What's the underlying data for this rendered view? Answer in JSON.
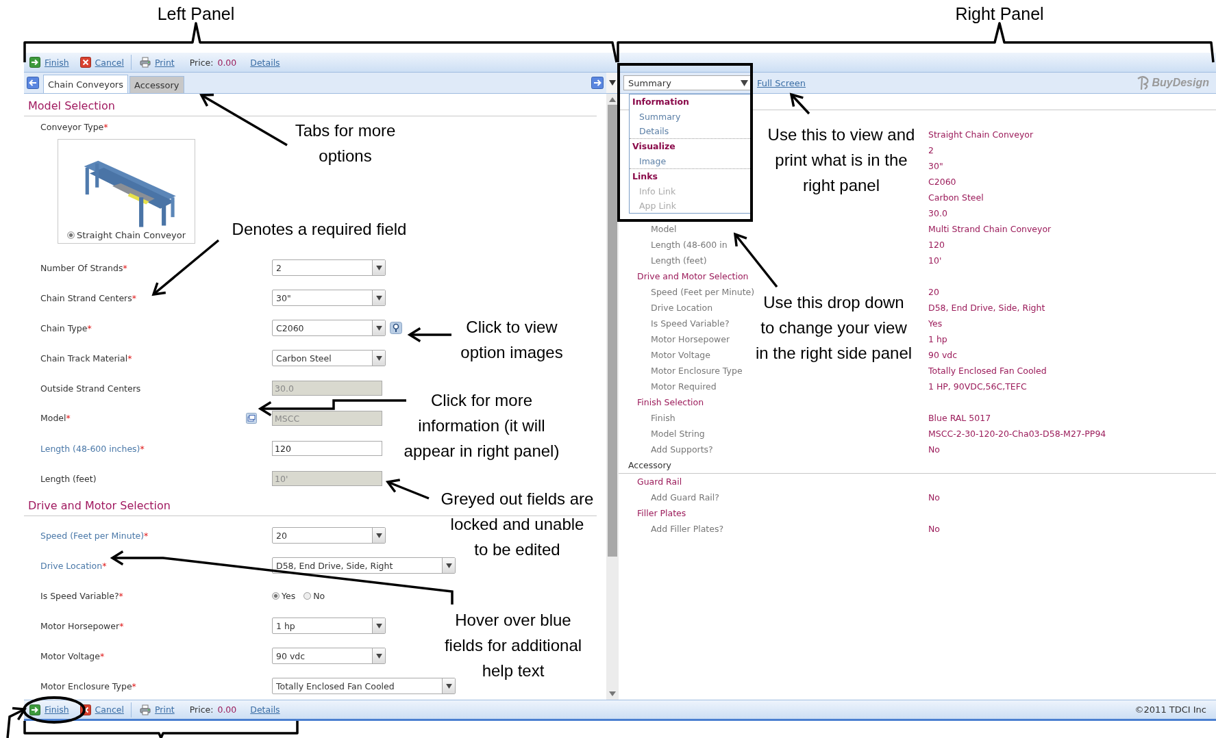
{
  "callouts": [
    {
      "kind": "panel",
      "lines": [
        "Left Panel"
      ]
    },
    {
      "kind": "panel",
      "lines": [
        "Right Panel"
      ]
    },
    {
      "kind": "note",
      "lines": [
        "Tabs for more",
        "options"
      ]
    },
    {
      "kind": "note",
      "lines": [
        "Denotes a required field"
      ]
    },
    {
      "kind": "note",
      "lines": [
        "Click to view",
        "option images"
      ]
    },
    {
      "kind": "note",
      "lines": [
        "Click for more",
        "information (it will",
        "appear in right panel)"
      ]
    },
    {
      "kind": "note",
      "lines": [
        "Greyed out fields are",
        "locked and unable",
        "to be edited"
      ]
    },
    {
      "kind": "note",
      "lines": [
        "Hover over blue",
        "fields for additional",
        "help text"
      ]
    },
    {
      "kind": "note",
      "lines": [
        "Use this to view and",
        "print what is in the",
        "right panel"
      ]
    },
    {
      "kind": "note",
      "lines": [
        "Use this drop down",
        "to change your view",
        "in the right side panel"
      ]
    }
  ],
  "toolbar": {
    "actions": [
      {
        "kind": "finish",
        "label": "Finish"
      },
      {
        "kind": "cancel",
        "label": "Cancel"
      },
      {
        "kind": "print",
        "label": "Print"
      }
    ],
    "price_label": "Price:",
    "price": "0.00",
    "details": "Details"
  },
  "tabs": [
    {
      "label": "Chain Conveyors",
      "selected": true
    },
    {
      "label": "Accessory",
      "selected": false
    }
  ],
  "view_select": {
    "value": "Summary",
    "menu": [
      {
        "kind": "group",
        "label": "Information"
      },
      {
        "kind": "item",
        "label": "Summary",
        "disabled": false
      },
      {
        "kind": "item",
        "label": "Details",
        "disabled": false
      },
      {
        "kind": "group",
        "label": "Visualize"
      },
      {
        "kind": "item",
        "label": "Image",
        "disabled": false
      },
      {
        "kind": "group",
        "label": "Links"
      },
      {
        "kind": "item",
        "label": "Info Link",
        "disabled": true
      },
      {
        "kind": "item",
        "label": "App Link",
        "disabled": true
      }
    ]
  },
  "full_screen": "Full Screen",
  "logo": "BuyDesign",
  "form": {
    "required_mark": "*",
    "sections": [
      {
        "title": "Model Selection",
        "fields": [
          {
            "kind": "image_choice",
            "label": "Conveyor Type",
            "required": true,
            "help": false,
            "option": {
              "label": "Straight Chain Conveyor",
              "selected": true
            }
          },
          {
            "kind": "select",
            "label": "Number Of Strands",
            "required": true,
            "help": false,
            "value": "2"
          },
          {
            "kind": "select",
            "label": "Chain Strand Centers",
            "required": true,
            "help": false,
            "value": "30\""
          },
          {
            "kind": "select",
            "label": "Chain Type",
            "required": true,
            "help": false,
            "value": "C2060",
            "extra": {
              "kind": "zoom"
            }
          },
          {
            "kind": "select",
            "label": "Chain Track Material",
            "required": true,
            "help": false,
            "value": "Carbon Steel"
          },
          {
            "kind": "text",
            "label": "Outside Strand Centers",
            "required": false,
            "help": false,
            "value": "30.0",
            "locked": true
          },
          {
            "kind": "text",
            "label": "Model",
            "required": true,
            "help": false,
            "value": "MSCC",
            "locked": true,
            "extra": {
              "kind": "info"
            }
          },
          {
            "kind": "text",
            "label": "Length (48-600 inches)",
            "required": true,
            "help": true,
            "value": "120",
            "locked": false
          },
          {
            "kind": "text",
            "label": "Length (feet)",
            "required": false,
            "help": false,
            "value": "10'",
            "locked": true
          }
        ]
      },
      {
        "title": "Drive and Motor Selection",
        "fields": [
          {
            "kind": "select",
            "label": "Speed (Feet per Minute)",
            "required": true,
            "help": true,
            "value": "20"
          },
          {
            "kind": "select",
            "label": "Drive Location",
            "required": true,
            "help": true,
            "value": "D58, End Drive, Side, Right"
          },
          {
            "kind": "radio",
            "label": "Is Speed Variable?",
            "required": true,
            "help": false,
            "options": [
              {
                "label": "Yes",
                "selected": true
              },
              {
                "label": "No",
                "selected": false
              }
            ]
          },
          {
            "kind": "select",
            "label": "Motor Horsepower",
            "required": true,
            "help": false,
            "value": "1 hp"
          },
          {
            "kind": "select",
            "label": "Motor Voltage",
            "required": true,
            "help": false,
            "value": "90 vdc"
          },
          {
            "kind": "select",
            "label": "Motor Enclosure Type",
            "required": true,
            "help": false,
            "value": "Totally Enclosed Fan Cooled"
          }
        ]
      }
    ]
  },
  "summary": [
    {
      "kind": "row",
      "value": "Straight Chain Conveyor"
    },
    {
      "kind": "row",
      "value": "2"
    },
    {
      "kind": "row",
      "value": "30\""
    },
    {
      "kind": "row",
      "value": "C2060"
    },
    {
      "kind": "row",
      "value": "Carbon Steel"
    },
    {
      "kind": "row",
      "value": "30.0"
    },
    {
      "kind": "row",
      "label": "Model",
      "value": "Multi Strand Chain Conveyor"
    },
    {
      "kind": "row",
      "label": "Length (48-600 in",
      "value": "120"
    },
    {
      "kind": "row",
      "label": "Length (feet)",
      "value": "10'"
    },
    {
      "kind": "section",
      "label": "Drive and Motor Selection"
    },
    {
      "kind": "row",
      "label": "Speed (Feet per Minute)",
      "value": "20"
    },
    {
      "kind": "row",
      "label": "Drive Location",
      "value": "D58, End Drive, Side, Right"
    },
    {
      "kind": "row",
      "label": "Is Speed Variable?",
      "value": "Yes"
    },
    {
      "kind": "row",
      "label": "Motor Horsepower",
      "value": "1 hp"
    },
    {
      "kind": "row",
      "label": "Motor Voltage",
      "value": "90 vdc"
    },
    {
      "kind": "row",
      "label": "Motor Enclosure Type",
      "value": "Totally Enclosed Fan Cooled"
    },
    {
      "kind": "row",
      "label": "Motor Required",
      "value": "1 HP, 90VDC,56C,TEFC"
    },
    {
      "kind": "section",
      "label": "Finish Selection"
    },
    {
      "kind": "row",
      "label": "Finish",
      "value": "Blue RAL 5017"
    },
    {
      "kind": "row",
      "label": "Model String",
      "value": "MSCC-2-30-120-20-Cha03-D58-M27-PP94"
    },
    {
      "kind": "row",
      "label": "Add Supports?",
      "value": "No"
    },
    {
      "kind": "tab",
      "label": "Accessory"
    },
    {
      "kind": "section",
      "label": "Guard Rail"
    },
    {
      "kind": "row",
      "label": "Add Guard Rail?",
      "value": "No"
    },
    {
      "kind": "section",
      "label": "Filler Plates"
    },
    {
      "kind": "row",
      "label": "Add Filler Plates?",
      "value": "No"
    }
  ],
  "bottom_bar": {
    "actions": [
      {
        "kind": "finish",
        "label": "Finish"
      },
      {
        "kind": "cancel",
        "label": "Cancel"
      },
      {
        "kind": "print",
        "label": "Print"
      }
    ],
    "price_label": "Price:",
    "price": "0.00",
    "details": "Details",
    "copyright": "©2011 TDCI Inc"
  }
}
